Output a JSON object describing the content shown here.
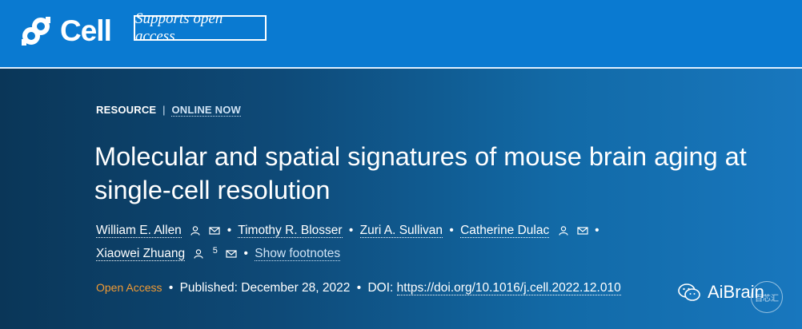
{
  "header": {
    "logo_text": "Cell",
    "badge": "Supports open access"
  },
  "article": {
    "type": "RESOURCE",
    "separator": "|",
    "status": "ONLINE NOW",
    "title": "Molecular and spatial signatures of mouse brain aging at single-cell resolution",
    "authors": [
      {
        "name": "William E. Allen"
      },
      {
        "name": "Timothy R. Blosser"
      },
      {
        "name": "Zuri A. Sullivan"
      },
      {
        "name": "Catherine Dulac"
      },
      {
        "name": "Xiaowei Zhuang",
        "sup": "5"
      }
    ],
    "bullet": "•",
    "show_footnotes": "Show footnotes",
    "open_access": "Open Access",
    "published_label": "Published: December 28, 2022",
    "doi_label": "DOI:",
    "doi": "https://doi.org/10.1016/j.cell.2022.12.010"
  },
  "watermark": {
    "text": "AiBrain",
    "small_text": "百芯汇"
  },
  "colors": {
    "header_bg": "#0a7ad1",
    "hero_bg_left": "#0a3658",
    "hero_bg_right": "#1877be",
    "open_access": "#f09a34"
  }
}
